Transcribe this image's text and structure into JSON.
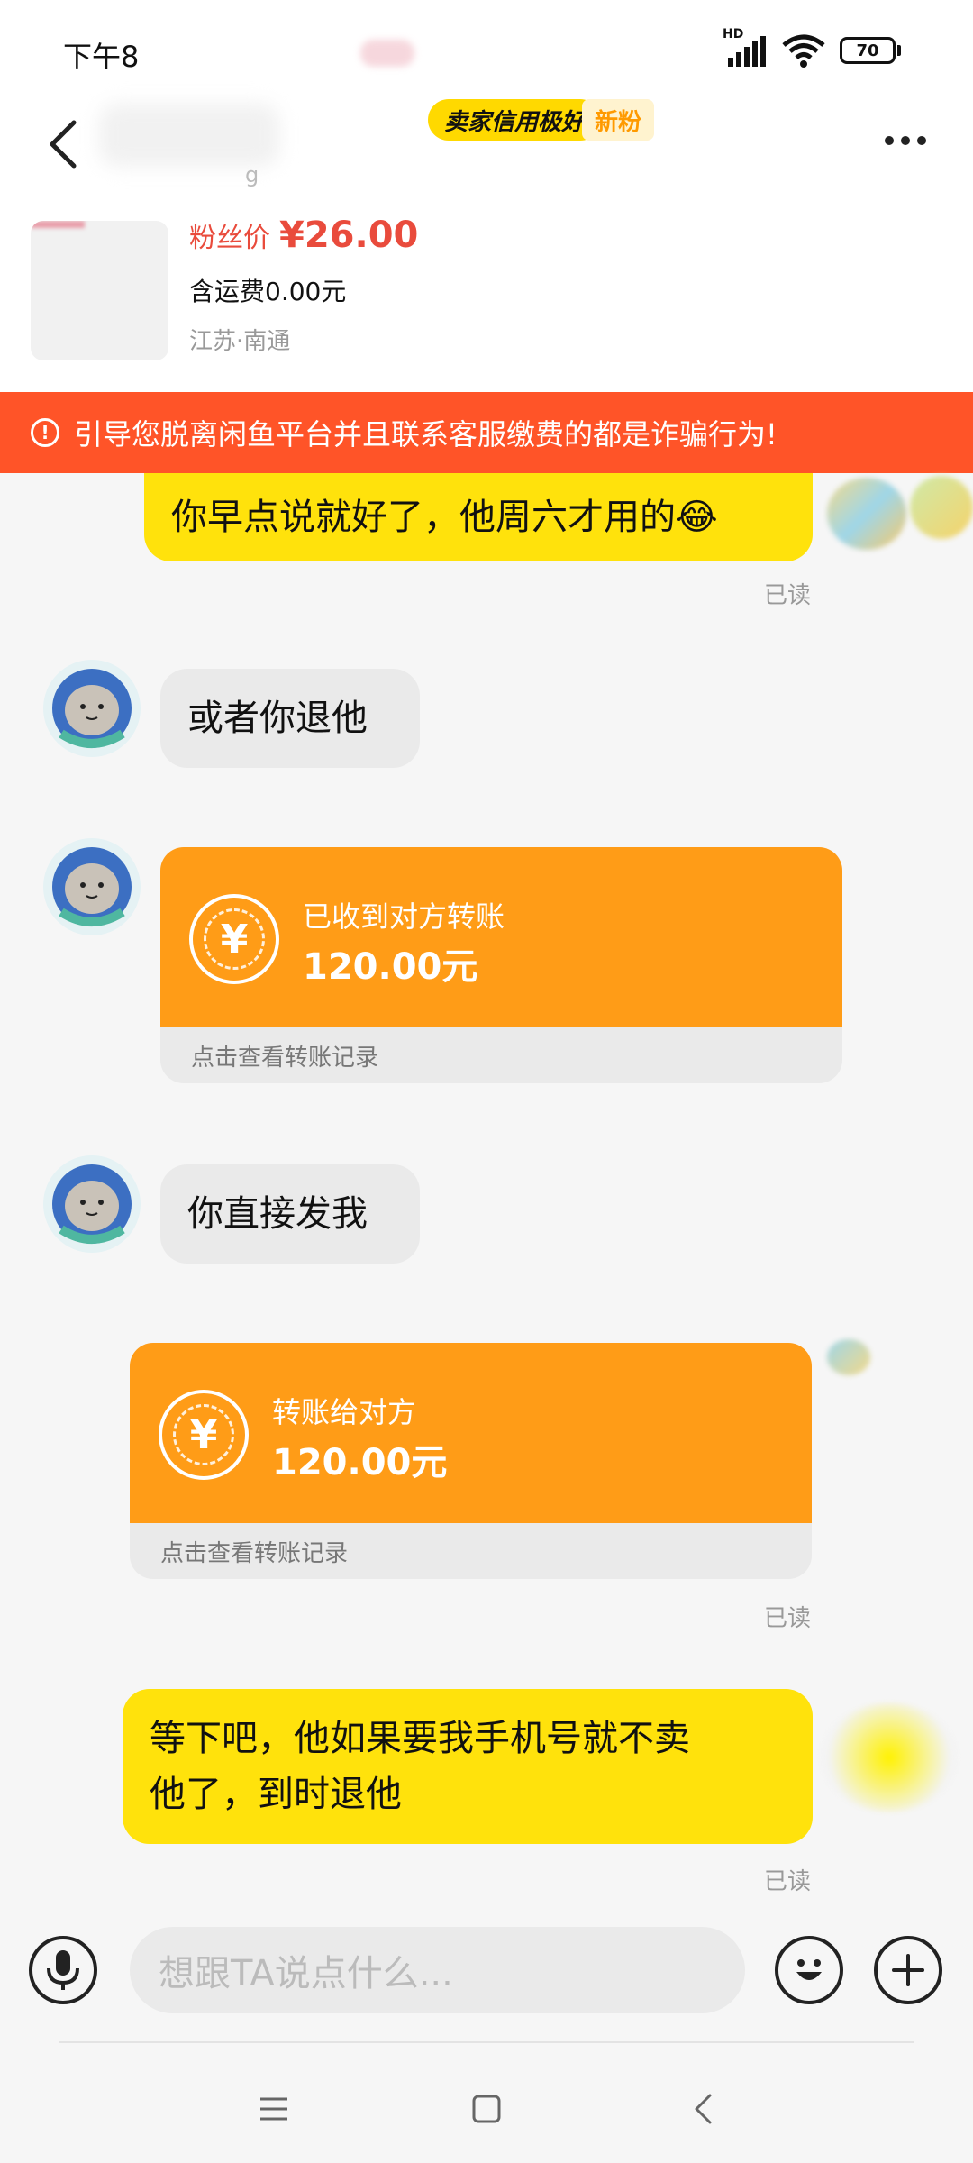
{
  "status_bar": {
    "time": "下午8",
    "network": "HD",
    "battery": "70"
  },
  "header": {
    "credit_badge": "卖家信用极好",
    "new_fan_badge": "新粉"
  },
  "product": {
    "price_label": "粉丝价",
    "price": "¥26.00",
    "shipping": "含运费0.00元",
    "location": "江苏·南通"
  },
  "warning": {
    "icon": "!",
    "text": "引导您脱离闲鱼平台并且联系客服缴费的都是诈骗行为!"
  },
  "messages": {
    "m1": {
      "text": "你早点说就好了，他周六才用的😂",
      "status": "已读"
    },
    "m2": {
      "text": "或者你退他"
    },
    "m3": {
      "title": "已收到对方转账",
      "amount": "120.00元",
      "link": "点击查看转账记录",
      "icon": "¥"
    },
    "m4": {
      "text": "你直接发我"
    },
    "m5": {
      "title": "转账给对方",
      "amount": "120.00元",
      "link": "点击查看转账记录",
      "icon": "¥",
      "status": "已读"
    },
    "m6": {
      "line1": "等下吧，他如果要我手机号就不卖",
      "line2": "他了，到时退他",
      "status": "已读"
    }
  },
  "input": {
    "placeholder": "想跟TA说点什么..."
  },
  "icons": {
    "back": "back-arrow-icon",
    "more": "more-dots-icon",
    "warning": "warning-circle-icon",
    "voice": "microphone-icon",
    "emoji": "emoji-icon",
    "plus": "plus-icon",
    "transfer": "yen-transfer-icon",
    "nav_menu": "menu-icon",
    "nav_home": "home-square-icon",
    "nav_back": "nav-back-icon"
  },
  "colors": {
    "accent_yellow": "#ffe20c",
    "transfer_orange": "#ff9c17",
    "warning_red": "#ff5428",
    "price_red": "#e94b3c"
  }
}
